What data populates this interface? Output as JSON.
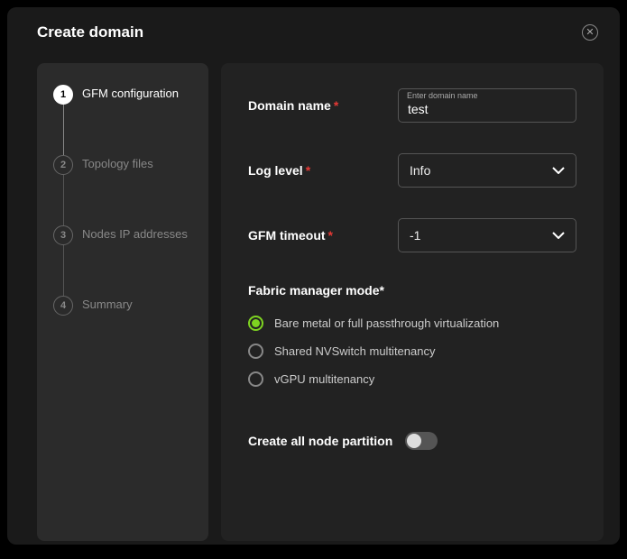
{
  "modal": {
    "title": "Create domain"
  },
  "stepper": {
    "steps": [
      {
        "num": "1",
        "label": "GFM configuration"
      },
      {
        "num": "2",
        "label": "Topology files"
      },
      {
        "num": "3",
        "label": "Nodes IP addresses"
      },
      {
        "num": "4",
        "label": "Summary"
      }
    ],
    "activeIndex": 0
  },
  "form": {
    "domainName": {
      "label": "Domain name",
      "placeholder": "Enter domain name",
      "value": "test"
    },
    "logLevel": {
      "label": "Log level",
      "value": "Info"
    },
    "gfmTimeout": {
      "label": "GFM timeout",
      "value": "-1"
    },
    "fabricMode": {
      "label": "Fabric manager mode",
      "options": [
        "Bare metal or full passthrough virtualization",
        "Shared NVSwitch multitenancy",
        "vGPU multitenancy"
      ],
      "selectedIndex": 0
    },
    "createAllNodePartition": {
      "label": "Create all node partition",
      "value": false
    }
  }
}
